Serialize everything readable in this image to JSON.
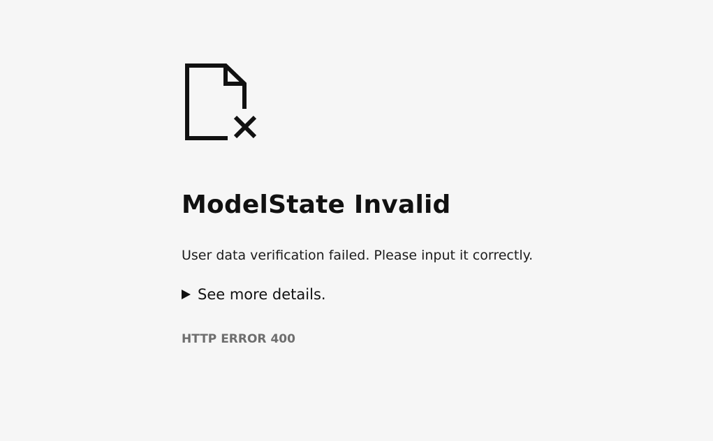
{
  "icon": "document-error-icon",
  "title": "ModelState Invalid",
  "message": "User data verification failed. Please input it correctly.",
  "details": {
    "label": "See more details.",
    "icon": "disclosure-triangle-icon"
  },
  "error_code": "HTTP ERROR 400",
  "colors": {
    "background": "#f6f6f6",
    "text": "#1b1b1b",
    "muted": "#6e6e6e"
  }
}
